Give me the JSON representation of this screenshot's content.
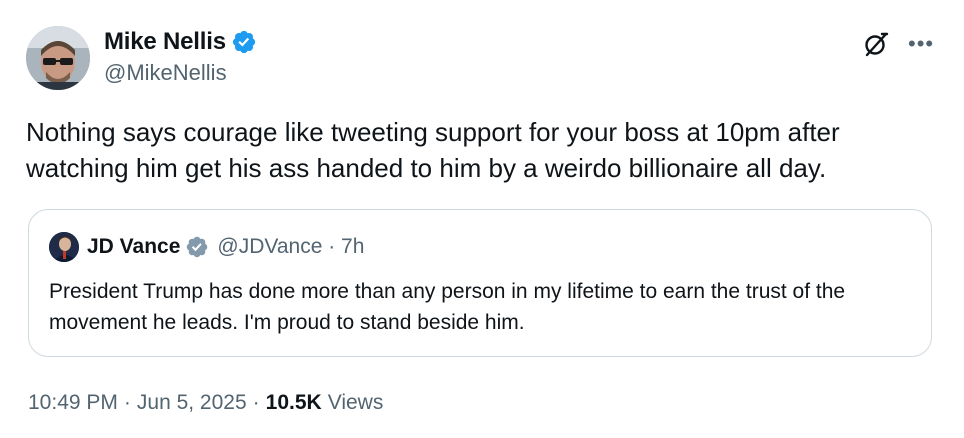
{
  "author": {
    "name": "Mike Nellis",
    "handle": "@MikeNellis"
  },
  "icons": {
    "verified": "verified-badge-icon",
    "grok": "grok-icon",
    "more": "more-options-icon"
  },
  "colors": {
    "verified_blue": "#1d9bf0",
    "verified_gray": "#829aab",
    "secondary_text": "#536471",
    "border": "#cfd9de"
  },
  "tweet": {
    "text": "Nothing says courage like tweeting support for your boss at 10pm after watching him get his ass handed to him by a weirdo billionaire all day."
  },
  "quote": {
    "name": "JD Vance",
    "handle_time": "@JDVance · 7h",
    "text": "President Trump has done more than any person in my lifetime to earn the trust of the movement he leads. I'm proud to stand beside him."
  },
  "meta": {
    "time": "10:49 PM",
    "date": "Jun 5, 2025",
    "separator": "·",
    "views_count": "10.5K",
    "views_label": "Views"
  }
}
